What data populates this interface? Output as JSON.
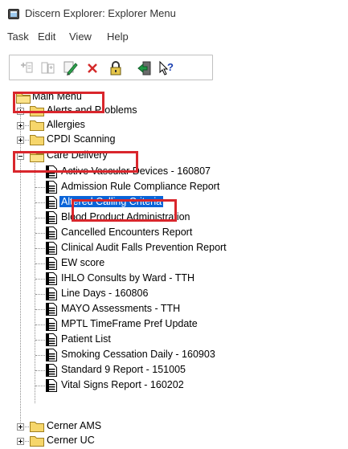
{
  "window": {
    "title": "Discern Explorer: Explorer Menu"
  },
  "menu": {
    "items": [
      "Task",
      "Edit",
      "View",
      "Help"
    ]
  },
  "toolbar": {
    "buttons": [
      "add-item-icon",
      "add-folder-icon",
      "pencil-edit-icon",
      "delete-icon",
      "lock-icon",
      "exit-icon",
      "help-icon"
    ]
  },
  "tree": {
    "root": {
      "label": "Main Menu"
    },
    "top_folders": [
      {
        "label": "Alerts and Problems"
      },
      {
        "label": "Allergies"
      },
      {
        "label": "CPDI Scanning"
      }
    ],
    "expanded_folder": {
      "label": "Care Delivery",
      "reports": [
        "Active Vascular Devices - 160807",
        "Admission Rule Compliance Report",
        "Altered Calling Criteria",
        "Blood Product Administration",
        "Cancelled Encounters Report",
        "Clinical Audit Falls Prevention Report",
        "EW score",
        "IHLO Consults by Ward - TTH",
        "Line Days - 160806",
        "MAYO Assessments - TTH",
        "MPTL TimeFrame Pref Update",
        "Patient List",
        "Smoking Cessation Daily - 160903",
        "Standard 9 Report - 151005",
        "Vital Signs Report - 160202"
      ],
      "selected_report": "Altered Calling Criteria"
    },
    "bottom_folders": [
      {
        "label": "Cerner AMS"
      },
      {
        "label": "Cerner UC"
      }
    ]
  },
  "colors": {
    "highlight": "#d9262c",
    "selection": "#0a64d8",
    "folder": "#f6d66b"
  }
}
